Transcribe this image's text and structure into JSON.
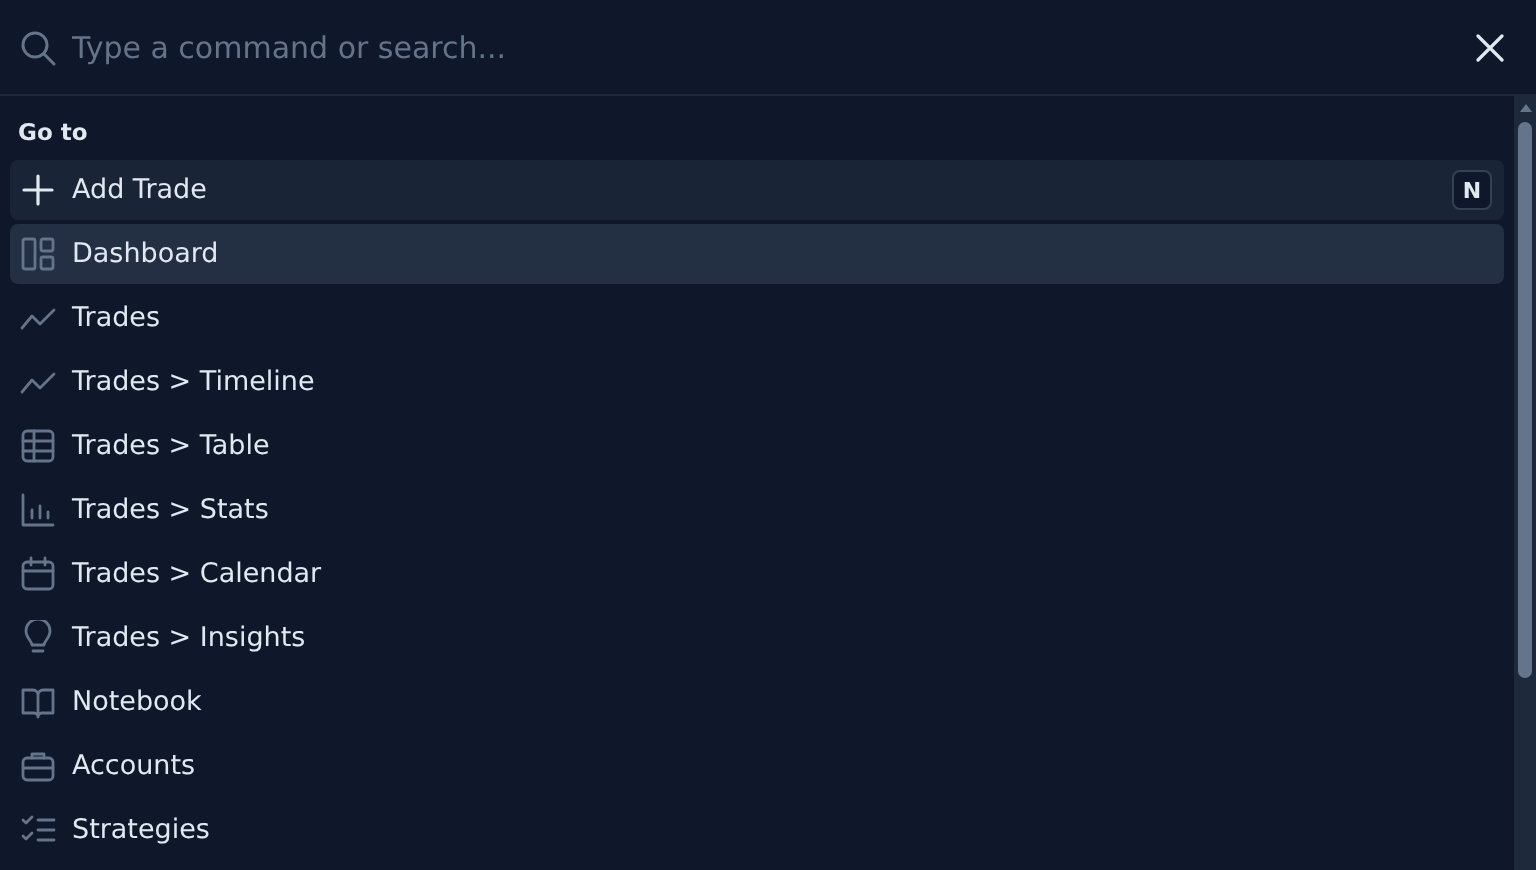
{
  "search": {
    "placeholder": "Type a command or search..."
  },
  "group": {
    "heading": "Go to"
  },
  "items": [
    {
      "label": "Add Trade",
      "hovered": true,
      "selected": false,
      "shortcut": "N"
    },
    {
      "label": "Dashboard",
      "hovered": false,
      "selected": true
    },
    {
      "label": "Trades",
      "hovered": false,
      "selected": false
    },
    {
      "label": "Trades > Timeline",
      "hovered": false,
      "selected": false
    },
    {
      "label": "Trades > Table",
      "hovered": false,
      "selected": false
    },
    {
      "label": "Trades > Stats",
      "hovered": false,
      "selected": false
    },
    {
      "label": "Trades > Calendar",
      "hovered": false,
      "selected": false
    },
    {
      "label": "Trades > Insights",
      "hovered": false,
      "selected": false
    },
    {
      "label": "Notebook",
      "hovered": false,
      "selected": false
    },
    {
      "label": "Accounts",
      "hovered": false,
      "selected": false
    },
    {
      "label": "Strategies",
      "hovered": false,
      "selected": false
    }
  ]
}
